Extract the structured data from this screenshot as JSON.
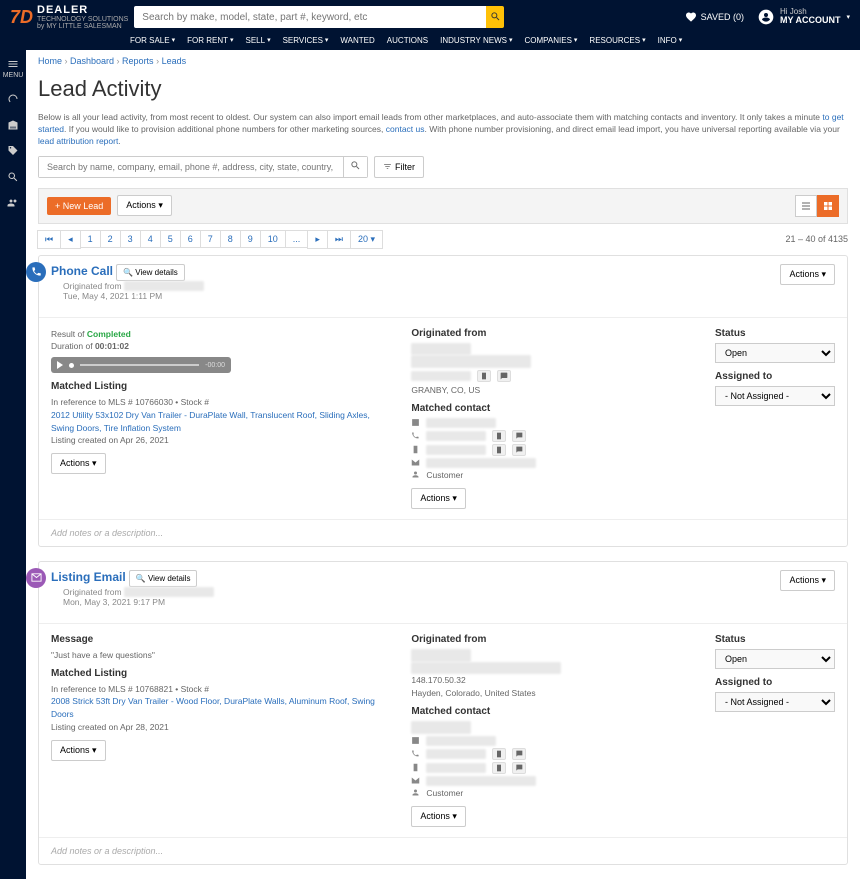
{
  "header": {
    "brand_line1": "DEALER",
    "brand_line2": "TECHNOLOGY SOLUTIONS",
    "brand_line3": "by MY LITTLE SALESMAN",
    "search_placeholder": "Search by make, model, state, part #, keyword, etc",
    "saved_label": "SAVED (0)",
    "hi": "Hi Josh",
    "account": "MY ACCOUNT"
  },
  "nav": {
    "items": [
      "FOR SALE",
      "FOR RENT",
      "SELL",
      "SERVICES",
      "WANTED",
      "AUCTIONS",
      "INDUSTRY NEWS",
      "COMPANIES",
      "RESOURCES",
      "INFO"
    ]
  },
  "side_menu": "MENU",
  "breadcrumb": {
    "home": "Home",
    "dashboard": "Dashboard",
    "reports": "Reports",
    "leads": "Leads"
  },
  "page_title": "Lead Activity",
  "description": {
    "p1": "Below is all your lead activity, from most recent to oldest. Our system can also import email leads from other marketplaces, and auto-associate them with matching contacts and inventory. It only takes a minute ",
    "link1": "to get started",
    "p2": ". If you would like to provision additional phone numbers for other marketing sources, ",
    "link2": "contact us",
    "p3": ". With phone number provisioning, and direct email lead import, you have universal reporting available via your ",
    "link3": "lead attribution report",
    "p4": "."
  },
  "search_placeholder": "Search by name, company, email, phone #, address, city, state, country, postal co",
  "filter_label": "Filter",
  "new_lead": "+ New Lead",
  "actions": "Actions",
  "pages": [
    "1",
    "2",
    "3",
    "4",
    "5",
    "6",
    "7",
    "8",
    "9",
    "10",
    "..."
  ],
  "page_size": "20",
  "count": "21 – 40 of 4135",
  "view_details": "View details",
  "status_label": "Status",
  "status_value": "Open",
  "assigned_label": "Assigned to",
  "assigned_value": "- Not Assigned -",
  "originated_label": "Originated from",
  "matched_contact": "Matched contact",
  "matched_listing": "Matched Listing",
  "customer": "Customer",
  "notes_placeholder": "Add notes or a description...",
  "lead1": {
    "title": "Phone Call",
    "originated": "Originated from",
    "date": "Tue, May 4, 2021 1:11 PM",
    "result": "Result of ",
    "completed": "Completed",
    "duration_l": "Duration of ",
    "duration": "00:01:02",
    "audio_time": "-00:00",
    "ref": "In reference to MLS # 10766030 • Stock #",
    "listing": "2012 Utility 53x102 Dry Van Trailer - DuraPlate Wall, Translucent Roof, Sliding Axles, Swing Doors, Tire Inflation System",
    "created": "Listing created on Apr 26, 2021",
    "location": "GRANBY, CO, US"
  },
  "lead2": {
    "title": "Listing Email",
    "originated": "Originated from",
    "date": "Mon, May 3, 2021 9:17 PM",
    "message_h": "Message",
    "message": "\"Just have a few questions\"",
    "ref": "In reference to MLS # 10768821 • Stock #",
    "listing": "2008 Strick 53ft Dry Van Trailer - Wood Floor, DuraPlate Walls, Aluminum Roof, Swing Doors",
    "created": "Listing created on Apr 28, 2021",
    "ip": "148.170.50.32",
    "location": "Hayden, Colorado, United States"
  }
}
